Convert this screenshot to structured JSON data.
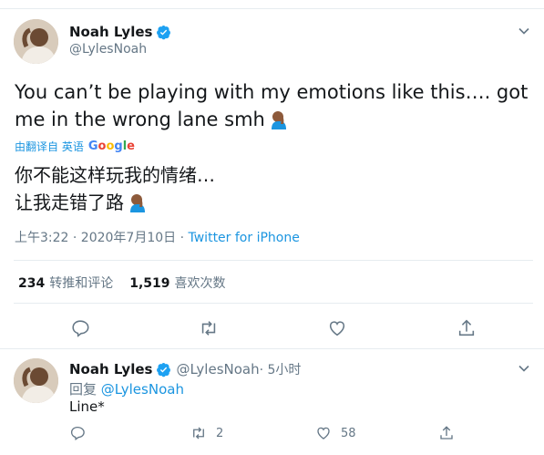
{
  "main_tweet": {
    "display_name": "Noah Lyles",
    "handle": "@LylesNoah",
    "text": "You can’t be playing with my emotions like this…. got me in the wrong lane smh",
    "emoji": "facepalm-emoji",
    "translation_label": "由翻译自 英语",
    "google_letters": [
      "G",
      "o",
      "o",
      "g",
      "l",
      "e"
    ],
    "translated_line1": "你不能这样玩我的情绪…",
    "translated_line2": "让我走错了路",
    "time_date": "上午3:22 · 2020年7月10日 · ",
    "source": "Twitter for iPhone",
    "retweets_count": "234",
    "retweets_label": "转推和评论",
    "likes_count": "1,519",
    "likes_label": "喜欢次数"
  },
  "reply": {
    "display_name": "Noah Lyles",
    "handle": "@LylesNoah",
    "time": " · 5小时",
    "reply_prefix": "回复 ",
    "reply_mention": "@LylesNoah",
    "text": "Line*",
    "retweets": "2",
    "likes": "58"
  },
  "colors": {
    "accent": "#1b95e0",
    "verified": "#1da1f2",
    "muted": "#657786",
    "text": "#14171a"
  }
}
